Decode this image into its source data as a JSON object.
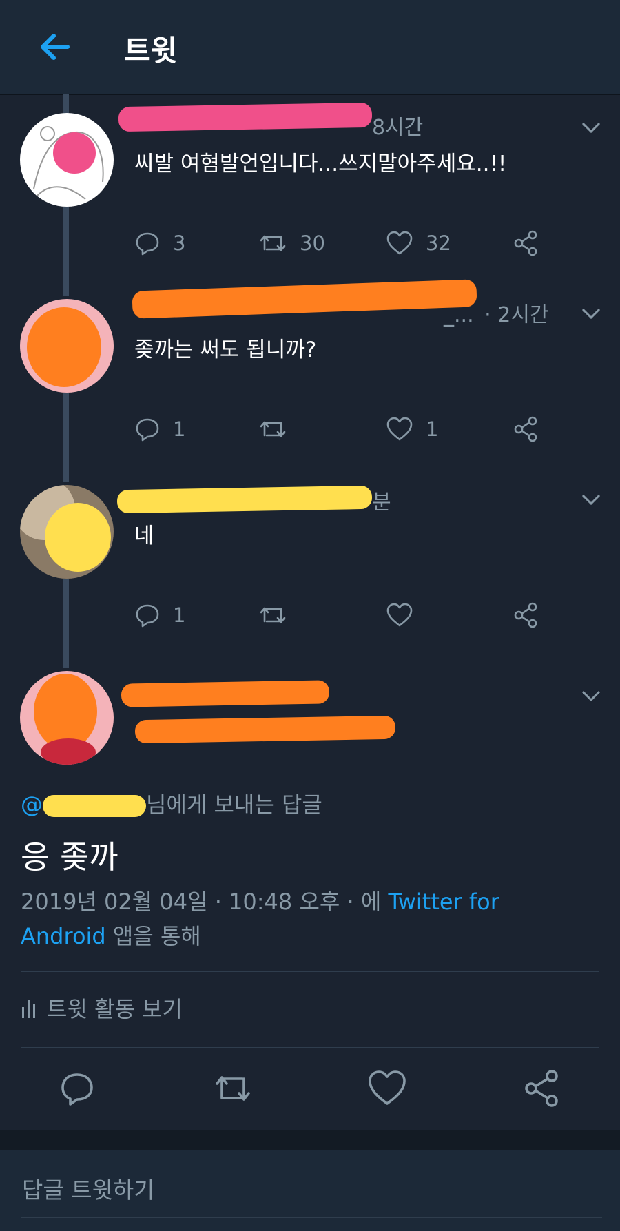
{
  "header": {
    "title": "트윗"
  },
  "tweets": [
    {
      "time": "8시간",
      "text": "씨발 여혐발언입니다...쓰지말아주세요..!!",
      "replies": "3",
      "retweets": "30",
      "likes": "32"
    },
    {
      "time": "· 2시간",
      "handle_tail": "_...",
      "text": "좆까는 써도 됩니까?",
      "replies": "1",
      "retweets": "",
      "likes": "1"
    },
    {
      "time": "분",
      "text": "네",
      "replies": "1",
      "retweets": "",
      "likes": ""
    }
  ],
  "main_tweet": {
    "reply_prefix": "@",
    "reply_suffix": "님에게 보내는 답글",
    "text": "응 좆까",
    "timestamp": "2019년 02월 04일 · 10:48 오후 · 에 ",
    "client_link_1": "Twitter for",
    "client_link_2": "Android",
    "client_suffix": " 앱을 통해",
    "activity": "트윗 활동 보기"
  },
  "reply_box": {
    "placeholder": "답글 트윗하기"
  },
  "colors": {
    "background": "#1b2330",
    "header": "#1c2938",
    "accent": "#1da1f2",
    "muted": "#8899a6",
    "redact_pink": "#f0508a",
    "redact_orange": "#ff7f1f",
    "redact_yellow": "#ffdf4f"
  },
  "icons": [
    "back-arrow-icon",
    "chevron-down-icon",
    "reply-icon",
    "retweet-icon",
    "like-icon",
    "share-icon",
    "bar-chart-icon"
  ]
}
